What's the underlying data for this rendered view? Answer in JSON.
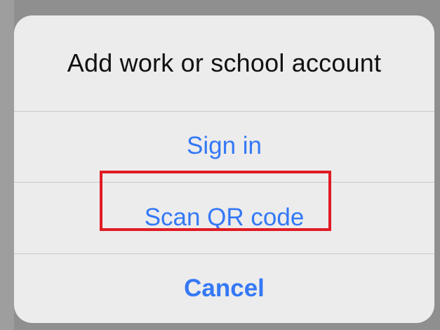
{
  "dialog": {
    "title": "Add work or school account",
    "actions": {
      "sign_in": "Sign in",
      "scan_qr": "Scan QR code",
      "cancel": "Cancel"
    }
  },
  "colors": {
    "accent": "#3478f6",
    "highlight": "#e01b24",
    "sheet_background": "#ececec",
    "overlay": "#8f8f8f"
  }
}
